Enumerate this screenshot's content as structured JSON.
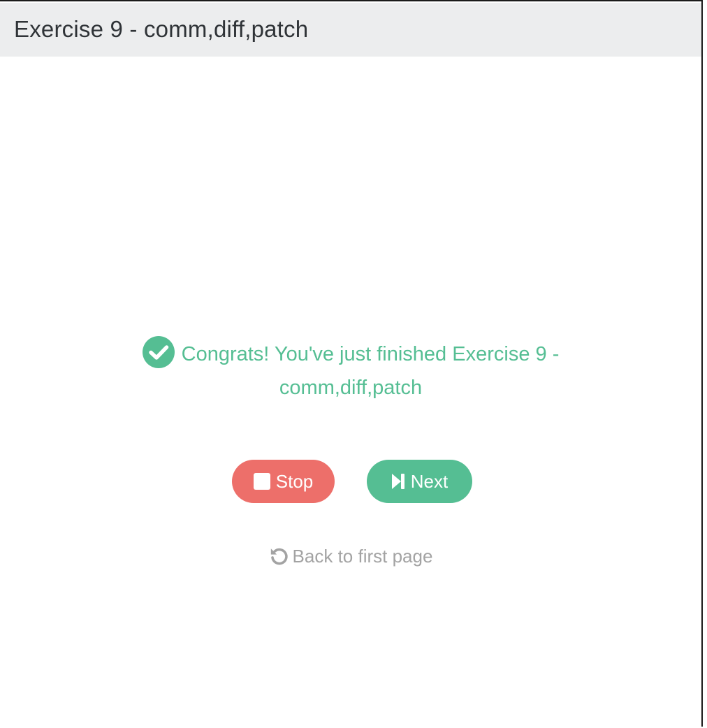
{
  "header": {
    "title": "Exercise 9 - comm,diff,patch"
  },
  "main": {
    "congrats_line1": "Congrats! You've just finished Exercise 9 -",
    "congrats_line2": "comm,diff,patch",
    "stop_label": "Stop",
    "next_label": "Next",
    "back_label": "Back to first page"
  },
  "icons": {
    "success": "check-circle-icon",
    "stop": "stop-square-icon",
    "next": "step-forward-icon",
    "back": "undo-icon"
  },
  "colors": {
    "success": "#55be93",
    "stop": "#ed6f6a",
    "muted": "#a3a3a3",
    "header_bg": "#ecedee"
  }
}
